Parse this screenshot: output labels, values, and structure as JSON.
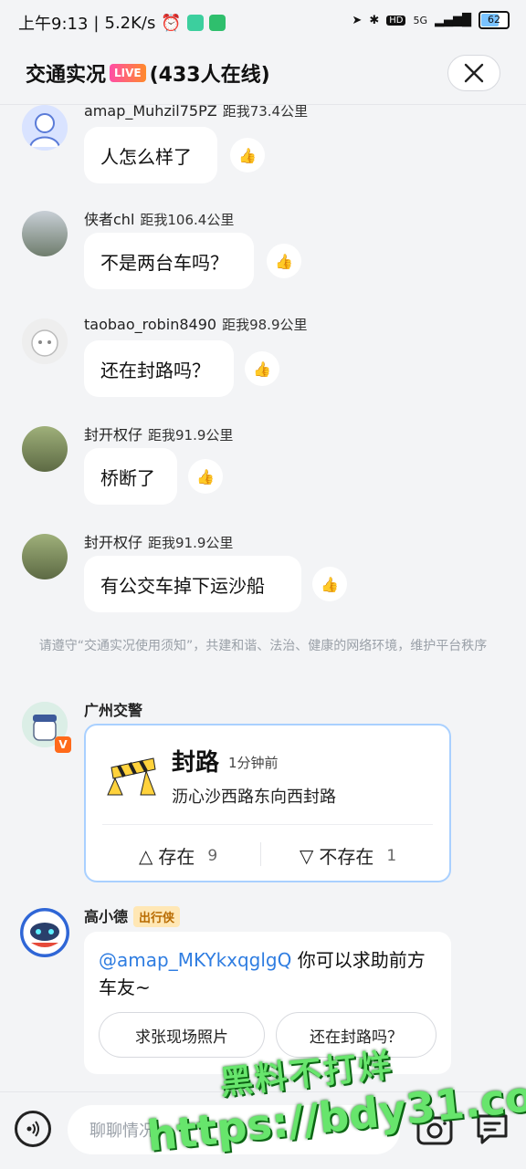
{
  "status_bar": {
    "time": "上午9:13",
    "net_speed": "5.2K/s",
    "hd": "HD",
    "network": "5G",
    "battery": "62"
  },
  "header": {
    "title": "交通实况",
    "live_badge": "LIVE",
    "online": "(433人在线)"
  },
  "messages": [
    {
      "user": "amap_Muhzil75PZ",
      "distance": "距我73.4公里",
      "text": "人怎么样了"
    },
    {
      "user": "侠者chl",
      "distance": "距我106.4公里",
      "text": "不是两台车吗？"
    },
    {
      "user": "taobao_robin8490",
      "distance": "距我98.9公里",
      "text": "还在封路吗？"
    },
    {
      "user": "封开权仔",
      "distance": "距我91.9公里",
      "text": "桥断了"
    },
    {
      "user": "封开权仔",
      "distance": "距我91.9公里",
      "text": "有公交车掉下运沙船"
    }
  ],
  "rules_notice": "请遵守“交通实况使用须知”，共建和谐、法治、健康的网络环境，维护平台秩序",
  "police_card": {
    "user": "广州交警",
    "title": "封路",
    "time": "1分钟前",
    "desc": "沥心沙西路东向西封路",
    "yes_label": "存在",
    "yes_count": "9",
    "no_label": "不存在",
    "no_count": "1"
  },
  "bot": {
    "user": "高小德",
    "tag": "出行侠",
    "mention": "@amap_MKYkxqglgQ",
    "text": " 你可以求助前方车友~",
    "chip1": "求张现场照片",
    "chip2": "还在封路吗？"
  },
  "bottom": {
    "placeholder": "聊聊情况"
  },
  "watermark": {
    "line1": "黑料不打烊",
    "line2": "https://bdy31.co"
  }
}
